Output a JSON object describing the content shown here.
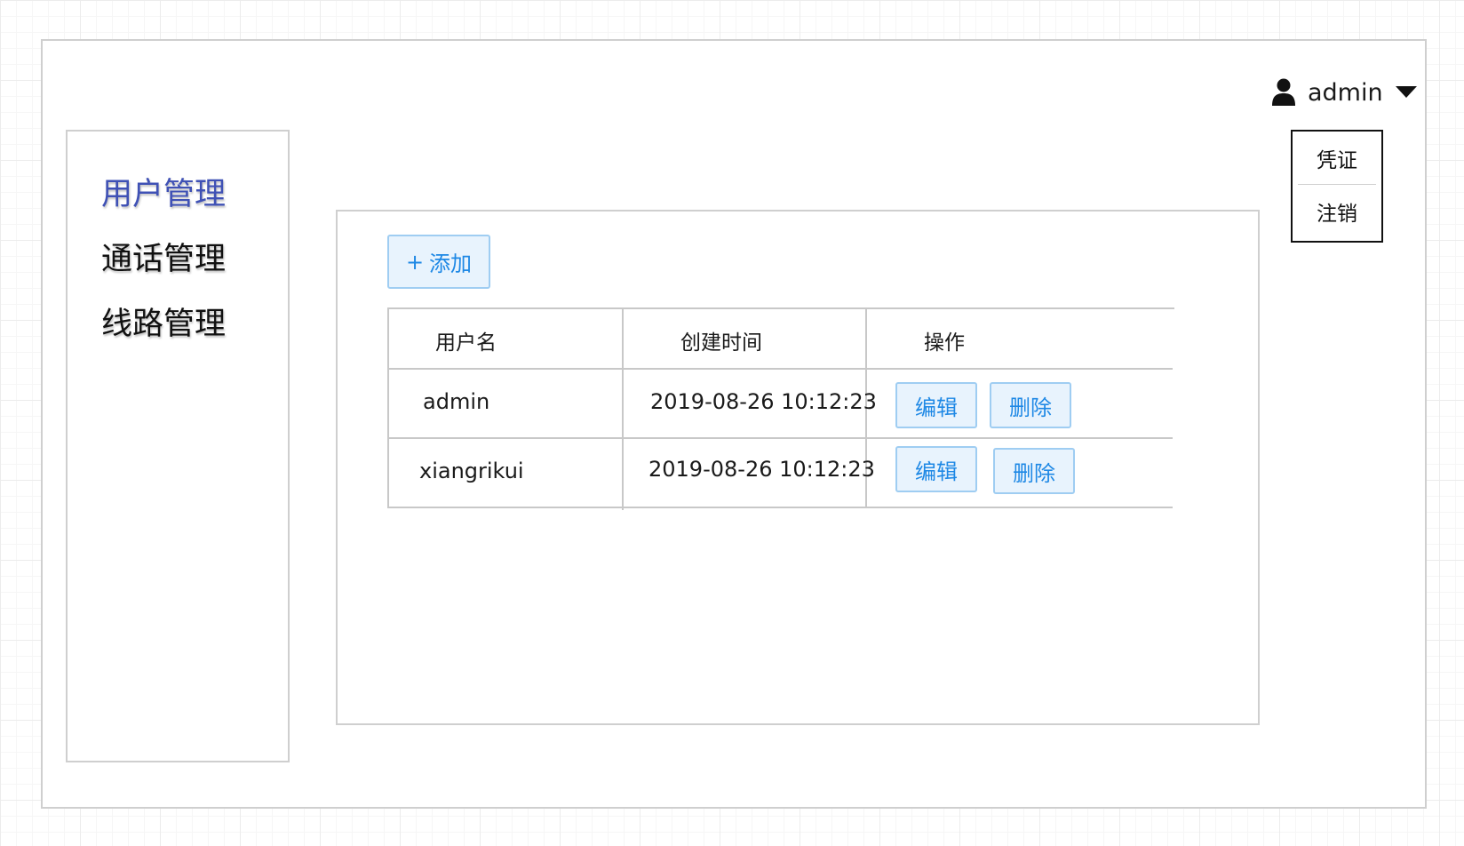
{
  "header": {
    "username": "admin",
    "icons": {
      "user": "user-icon",
      "dropdown": "caret-down-icon"
    }
  },
  "user_menu": {
    "items": [
      "凭证",
      "注销"
    ]
  },
  "sidebar": {
    "items": [
      {
        "label": "用户管理",
        "active": true
      },
      {
        "label": "通话管理",
        "active": false
      },
      {
        "label": "线路管理",
        "active": false
      }
    ]
  },
  "toolbar": {
    "add_label": "添加",
    "add_icon": "+"
  },
  "table": {
    "columns": [
      "用户名",
      "创建时间",
      "操作"
    ],
    "rows": [
      {
        "username": "admin",
        "created": "2019-08-26 10:12:23"
      },
      {
        "username": "xiangrikui",
        "created": "2019-08-26 10:12:23"
      }
    ],
    "actions": {
      "edit": "编辑",
      "delete": "删除"
    }
  },
  "colors": {
    "accent": "#1e88e5",
    "button_bg": "#e8f3fd",
    "button_border": "#9fcdf2",
    "active_menu": "#3f51b5",
    "border": "#cfcfcf"
  }
}
